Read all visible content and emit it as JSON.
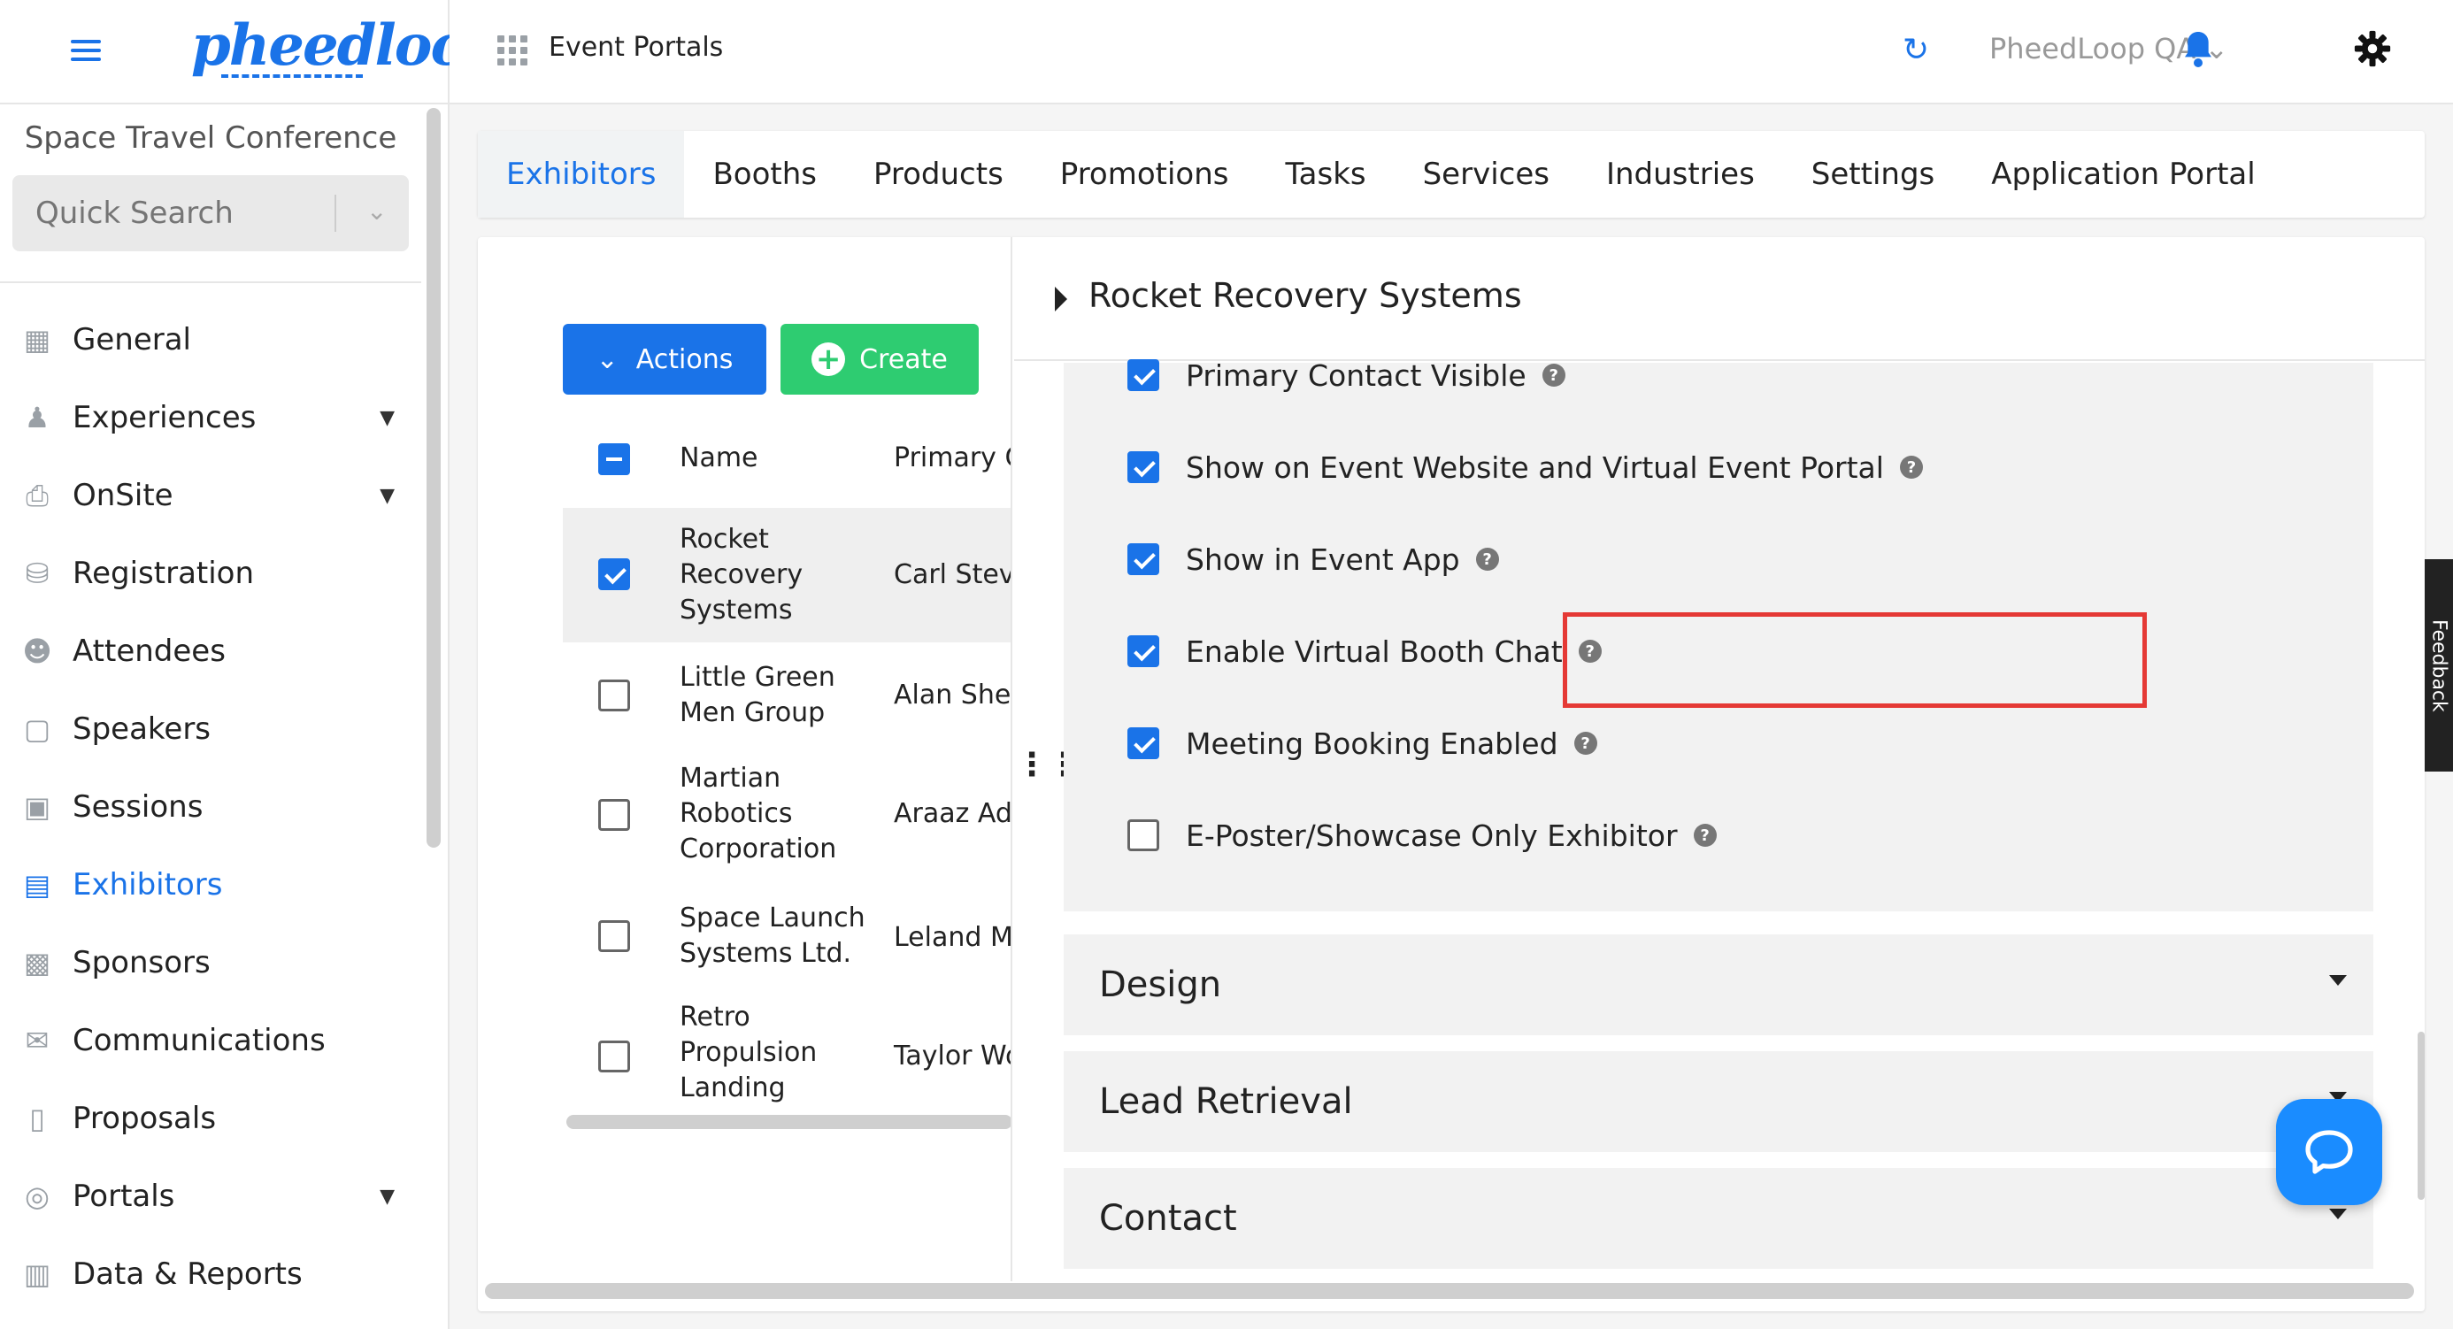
{
  "brand": {
    "logo_text": "pheedloop",
    "accent": "#1a73e8",
    "green": "#2ecc71",
    "highlight": "#e53935"
  },
  "sidebar": {
    "event_name": "Space Travel Conference",
    "search_placeholder": "Quick Search",
    "items": [
      {
        "label": "General",
        "icon": "grid-icon",
        "has_caret": false
      },
      {
        "label": "Experiences",
        "icon": "person-icon",
        "has_caret": true
      },
      {
        "label": "OnSite",
        "icon": "printer-icon",
        "has_caret": true
      },
      {
        "label": "Registration",
        "icon": "cart-icon",
        "has_caret": false
      },
      {
        "label": "Attendees",
        "icon": "people-icon",
        "has_caret": false
      },
      {
        "label": "Speakers",
        "icon": "presenter-icon",
        "has_caret": false
      },
      {
        "label": "Sessions",
        "icon": "laptop-icon",
        "has_caret": false
      },
      {
        "label": "Exhibitors",
        "icon": "storefront-icon",
        "has_caret": false,
        "active": true
      },
      {
        "label": "Sponsors",
        "icon": "badge-icon",
        "has_caret": false
      },
      {
        "label": "Communications",
        "icon": "mail-icon",
        "has_caret": false
      },
      {
        "label": "Proposals",
        "icon": "document-icon",
        "has_caret": false
      },
      {
        "label": "Portals",
        "icon": "globe-icon",
        "has_caret": true
      },
      {
        "label": "Data & Reports",
        "icon": "chart-icon",
        "has_caret": false
      }
    ]
  },
  "topbar": {
    "title": "Event Portals",
    "org": "PheedLoop QA"
  },
  "tabs": [
    "Exhibitors",
    "Booths",
    "Products",
    "Promotions",
    "Tasks",
    "Services",
    "Industries",
    "Settings",
    "Application Portal"
  ],
  "list": {
    "actions_label": "Actions",
    "create_label": "Create",
    "col_name": "Name",
    "col_contact": "Primary C",
    "rows": [
      {
        "name": [
          "Rocket",
          "Recovery",
          "Systems"
        ],
        "contact": "Carl Steve",
        "checked": true
      },
      {
        "name": [
          "Little Green",
          "Men Group"
        ],
        "contact": "Alan Shep",
        "checked": false
      },
      {
        "name": [
          "Martian",
          "Robotics",
          "Corporation"
        ],
        "contact": "Araaz Ade",
        "checked": false
      },
      {
        "name": [
          "Space Launch",
          "Systems Ltd."
        ],
        "contact": "Leland Me",
        "checked": false
      },
      {
        "name": [
          "Retro",
          "Propulsion",
          "Landing"
        ],
        "contact": "Taylor Wo",
        "checked": false
      }
    ]
  },
  "detail": {
    "title": "Rocket Recovery Systems",
    "settings": [
      {
        "label": "Primary Contact Visible",
        "checked": true
      },
      {
        "label": "Show on Event Website and Virtual Event Portal",
        "checked": true
      },
      {
        "label": "Show in Event App",
        "checked": true
      },
      {
        "label": "Enable Virtual Booth Chat",
        "checked": true
      },
      {
        "label": "Meeting Booking Enabled",
        "checked": true
      },
      {
        "label": "E-Poster/Showcase Only Exhibitor",
        "checked": false
      }
    ],
    "sections": [
      "Design",
      "Lead Retrieval",
      "Contact"
    ]
  },
  "feedback_label": "Feedback"
}
